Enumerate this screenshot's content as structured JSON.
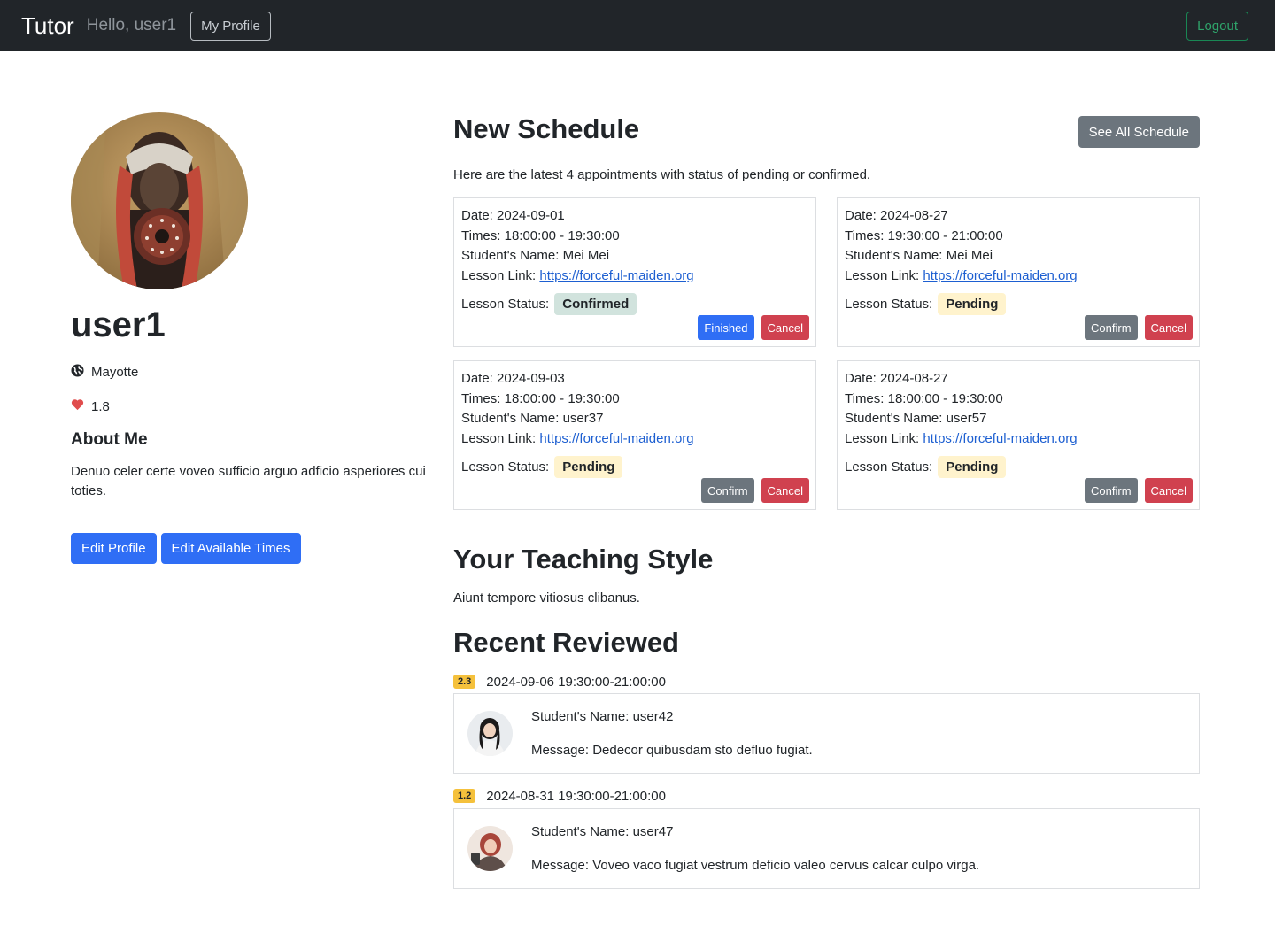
{
  "navbar": {
    "brand": "Tutor",
    "greeting": "Hello, user1",
    "profile_button": "My Profile",
    "logout_button": "Logout"
  },
  "profile": {
    "username": "user1",
    "country": "Mayotte",
    "rating": "1.8",
    "about_title": "About Me",
    "about_text": "Denuo celer certe voveo sufficio arguo adficio asperiores cui toties.",
    "edit_profile_button": "Edit Profile",
    "edit_times_button": "Edit Available Times"
  },
  "schedule": {
    "title": "New Schedule",
    "see_all_button": "See All Schedule",
    "description": "Here are the latest 4 appointments with status of pending or confirmed.",
    "appointments": [
      {
        "date": "Date: 2024-09-01",
        "times": "Times: 18:00:00 - 19:30:00",
        "student": "Student's Name: Mei Mei",
        "link_label": "Lesson Link: ",
        "link": "https://forceful-maiden.org",
        "status_label": "Lesson Status:",
        "status": "Confirmed",
        "primary_action": "Finished",
        "cancel": "Cancel"
      },
      {
        "date": "Date: 2024-08-27",
        "times": "Times: 19:30:00 - 21:00:00",
        "student": "Student's Name: Mei Mei",
        "link_label": "Lesson Link: ",
        "link": "https://forceful-maiden.org",
        "status_label": "Lesson Status:",
        "status": "Pending",
        "primary_action": "Confirm",
        "cancel": "Cancel"
      },
      {
        "date": "Date: 2024-09-03",
        "times": "Times: 18:00:00 - 19:30:00",
        "student": "Student's Name: user37",
        "link_label": "Lesson Link: ",
        "link": "https://forceful-maiden.org",
        "status_label": "Lesson Status:",
        "status": "Pending",
        "primary_action": "Confirm",
        "cancel": "Cancel"
      },
      {
        "date": "Date: 2024-08-27",
        "times": "Times: 18:00:00 - 19:30:00",
        "student": "Student's Name: user57",
        "link_label": "Lesson Link: ",
        "link": "https://forceful-maiden.org",
        "status_label": "Lesson Status:",
        "status": "Pending",
        "primary_action": "Confirm",
        "cancel": "Cancel"
      }
    ]
  },
  "teaching_style": {
    "title": "Your Teaching Style",
    "text": "Aiunt tempore vitiosus clibanus."
  },
  "reviews": {
    "title": "Recent Reviewed",
    "items": [
      {
        "score": "2.3",
        "datetime": "2024-09-06 19:30:00-21:00:00",
        "student": "Student's Name: user42",
        "message": "Message: Dedecor quibusdam sto defluo fugiat."
      },
      {
        "score": "1.2",
        "datetime": "2024-08-31 19:30:00-21:00:00",
        "student": "Student's Name: user47",
        "message": "Message: Voveo vaco fugiat vestrum deficio valeo cervus calcar culpo virga."
      }
    ]
  },
  "colors": {
    "navbar_bg": "#212529",
    "primary": "#2f6ef5",
    "secondary": "#6c757d",
    "danger": "#d0414f",
    "success": "#198754",
    "badge_confirmed": "#d1e3dd",
    "badge_pending": "#fff3cd",
    "rating_badge": "#f5c13c"
  },
  "icons": {
    "country": "globe-icon",
    "rating": "heart-icon"
  }
}
